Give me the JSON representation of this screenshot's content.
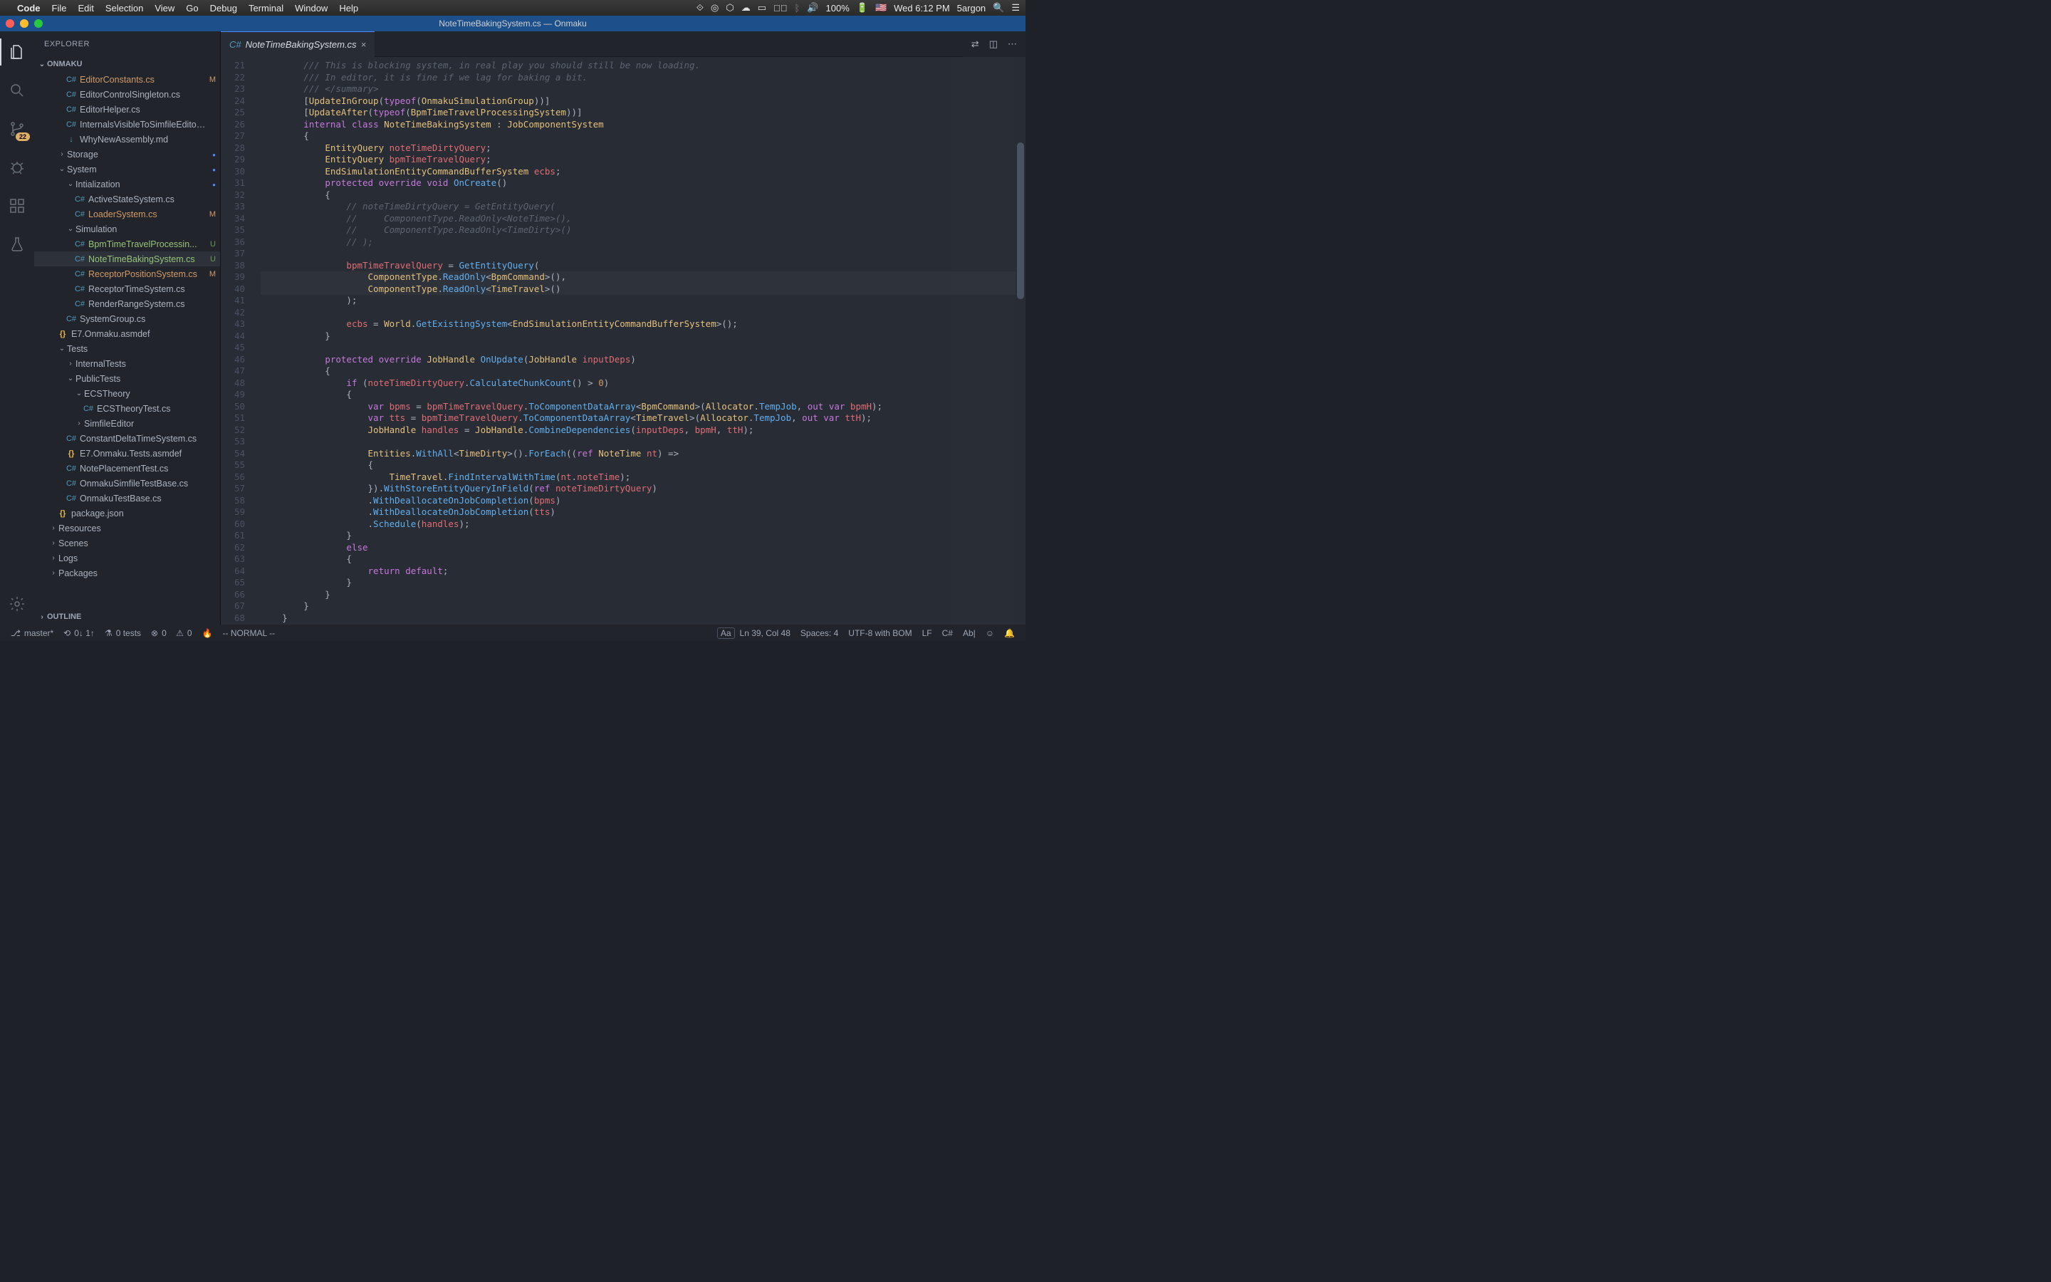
{
  "macos": {
    "app": "Code",
    "menu": [
      "File",
      "Edit",
      "Selection",
      "View",
      "Go",
      "Debug",
      "Terminal",
      "Window",
      "Help"
    ],
    "right": {
      "battery": "100%",
      "clock": "Wed 6:12 PM",
      "user": "5argon"
    }
  },
  "title": "NoteTimeBakingSystem.cs — Onmaku",
  "sidebar": {
    "header": "EXPLORER",
    "workspace": "ONMAKU",
    "outline": "OUTLINE",
    "tree": [
      {
        "depth": 2,
        "kind": "cs",
        "label": "EditorConstants.cs",
        "status": "M",
        "cls": "modified"
      },
      {
        "depth": 2,
        "kind": "cs",
        "label": "EditorControlSingleton.cs"
      },
      {
        "depth": 2,
        "kind": "cs",
        "label": "EditorHelper.cs"
      },
      {
        "depth": 2,
        "kind": "cs",
        "label": "InternalsVisibleToSimfileEditor.cs"
      },
      {
        "depth": 2,
        "kind": "md",
        "label": "WhyNewAssembly.md"
      },
      {
        "depth": 1,
        "kind": "folder",
        "expand": ">",
        "label": "Storage",
        "dot": true
      },
      {
        "depth": 1,
        "kind": "folder",
        "expand": "v",
        "label": "System",
        "dot": true
      },
      {
        "depth": 2,
        "kind": "folder",
        "expand": "v",
        "label": "Intialization",
        "dot": true
      },
      {
        "depth": 3,
        "kind": "cs",
        "label": "ActiveStateSystem.cs"
      },
      {
        "depth": 3,
        "kind": "cs",
        "label": "LoaderSystem.cs",
        "status": "M",
        "cls": "modified"
      },
      {
        "depth": 2,
        "kind": "folder",
        "expand": "v",
        "label": "Simulation"
      },
      {
        "depth": 3,
        "kind": "cs",
        "label": "BpmTimeTravelProcessin...",
        "status": "U",
        "cls": "untracked"
      },
      {
        "depth": 3,
        "kind": "cs",
        "label": "NoteTimeBakingSystem.cs",
        "status": "U",
        "cls": "untracked",
        "active": true
      },
      {
        "depth": 3,
        "kind": "cs",
        "label": "ReceptorPositionSystem.cs",
        "status": "M",
        "cls": "modified"
      },
      {
        "depth": 3,
        "kind": "cs",
        "label": "ReceptorTimeSystem.cs"
      },
      {
        "depth": 3,
        "kind": "cs",
        "label": "RenderRangeSystem.cs"
      },
      {
        "depth": 2,
        "kind": "cs",
        "label": "SystemGroup.cs"
      },
      {
        "depth": 1,
        "kind": "json",
        "label": "E7.Onmaku.asmdef"
      },
      {
        "depth": 1,
        "kind": "folder",
        "expand": "v",
        "label": "Tests"
      },
      {
        "depth": 2,
        "kind": "folder",
        "expand": ">",
        "label": "InternalTests"
      },
      {
        "depth": 2,
        "kind": "folder",
        "expand": "v",
        "label": "PublicTests"
      },
      {
        "depth": 3,
        "kind": "folder",
        "expand": "v",
        "label": "ECSTheory"
      },
      {
        "depth": 4,
        "kind": "cs",
        "label": "ECSTheoryTest.cs"
      },
      {
        "depth": 3,
        "kind": "folder",
        "expand": ">",
        "label": "SimfileEditor"
      },
      {
        "depth": 2,
        "kind": "cs",
        "label": "ConstantDeltaTimeSystem.cs"
      },
      {
        "depth": 2,
        "kind": "json",
        "label": "E7.Onmaku.Tests.asmdef"
      },
      {
        "depth": 2,
        "kind": "cs",
        "label": "NotePlacementTest.cs"
      },
      {
        "depth": 2,
        "kind": "cs",
        "label": "OnmakuSimfileTestBase.cs"
      },
      {
        "depth": 2,
        "kind": "cs",
        "label": "OnmakuTestBase.cs"
      },
      {
        "depth": 1,
        "kind": "json",
        "label": "package.json"
      },
      {
        "depth": 0,
        "kind": "folder",
        "expand": ">",
        "label": "Resources"
      },
      {
        "depth": 0,
        "kind": "folder",
        "expand": ">",
        "label": "Scenes"
      },
      {
        "depth": 0,
        "kind": "folder",
        "expand": ">",
        "label": "Logs"
      },
      {
        "depth": 0,
        "kind": "folder",
        "expand": ">",
        "label": "Packages"
      }
    ]
  },
  "scm_badge": "22",
  "tab": {
    "title": "NoteTimeBakingSystem.cs"
  },
  "code": {
    "first_line": 21,
    "highlight_lines": [
      39,
      40
    ],
    "lines": [
      "        /// This is blocking system, in real play you should still be now loading.",
      "        /// In editor, it is fine if we lag for baking a bit.",
      "        /// </summary>",
      "        [UpdateInGroup(typeof(OnmakuSimulationGroup))]",
      "        [UpdateAfter(typeof(BpmTimeTravelProcessingSystem))]",
      "        internal class NoteTimeBakingSystem : JobComponentSystem",
      "        {",
      "            EntityQuery noteTimeDirtyQuery;",
      "            EntityQuery bpmTimeTravelQuery;",
      "            EndSimulationEntityCommandBufferSystem ecbs;",
      "            protected override void OnCreate()",
      "            {",
      "                // noteTimeDirtyQuery = GetEntityQuery(",
      "                //     ComponentType.ReadOnly<NoteTime>(),",
      "                //     ComponentType.ReadOnly<TimeDirty>()",
      "                // );",
      "",
      "                bpmTimeTravelQuery = GetEntityQuery(",
      "                    ComponentType.ReadOnly<BpmCommand>(),",
      "                    ComponentType.ReadOnly<TimeTravel>()",
      "                );",
      "",
      "                ecbs = World.GetExistingSystem<EndSimulationEntityCommandBufferSystem>();",
      "            }",
      "",
      "            protected override JobHandle OnUpdate(JobHandle inputDeps)",
      "            {",
      "                if (noteTimeDirtyQuery.CalculateChunkCount() > 0)",
      "                {",
      "                    var bpms = bpmTimeTravelQuery.ToComponentDataArray<BpmCommand>(Allocator.TempJob, out var bpmH);",
      "                    var tts = bpmTimeTravelQuery.ToComponentDataArray<TimeTravel>(Allocator.TempJob, out var ttH);",
      "                    JobHandle handles = JobHandle.CombineDependencies(inputDeps, bpmH, ttH);",
      "",
      "                    Entities.WithAll<TimeDirty>().ForEach((ref NoteTime nt) =>",
      "                    {",
      "                        TimeTravel.FindIntervalWithTime(nt.noteTime);",
      "                    }).WithStoreEntityQueryInField(ref noteTimeDirtyQuery)",
      "                    .WithDeallocateOnJobCompletion(bpms)",
      "                    .WithDeallocateOnJobCompletion(tts)",
      "                    .Schedule(handles);",
      "                }",
      "                else",
      "                {",
      "                    return default;",
      "                }",
      "            }",
      "        }",
      "    }"
    ]
  },
  "statusbar": {
    "branch": "master*",
    "sync": "0↓ 1↑",
    "tests": "0 tests",
    "errors": "0",
    "warnings": "0",
    "mode": "-- NORMAL --",
    "search_case": "Aa",
    "cursor": "Ln 39, Col 48",
    "spaces": "Spaces: 4",
    "encoding": "UTF-8 with BOM",
    "eol": "LF",
    "lang": "C#",
    "ab": "Ab|"
  }
}
